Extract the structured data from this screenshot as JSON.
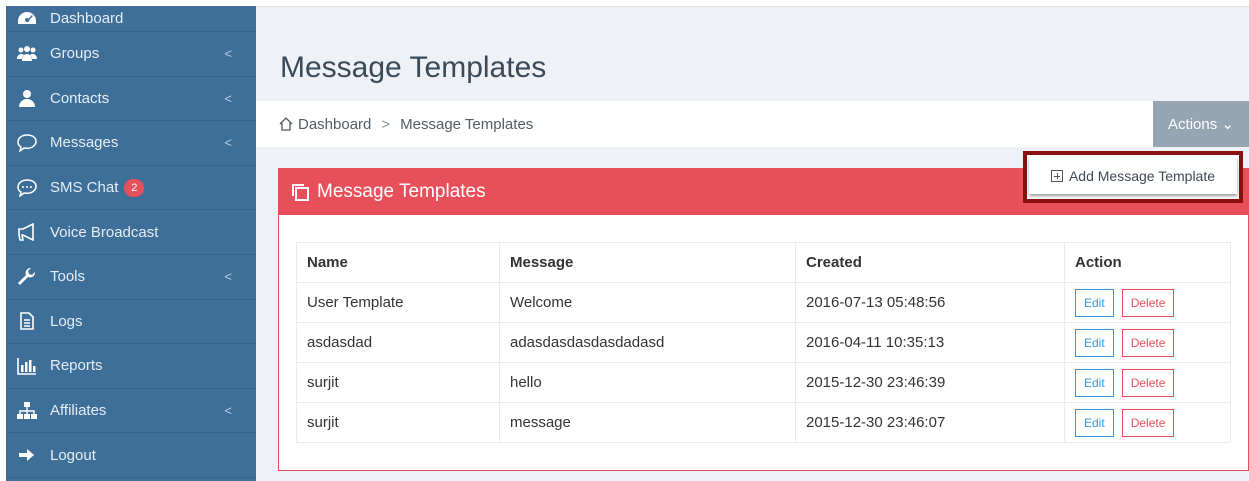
{
  "sidebar": {
    "items": [
      {
        "label": "Dashboard",
        "icon": "dashboard-icon",
        "has_chevron": false
      },
      {
        "label": "Groups",
        "icon": "users-icon",
        "has_chevron": true
      },
      {
        "label": "Contacts",
        "icon": "user-icon",
        "has_chevron": true
      },
      {
        "label": "Messages",
        "icon": "chat-bubble-icon",
        "has_chevron": true
      },
      {
        "label": "SMS Chat",
        "icon": "sms-chat-icon",
        "has_chevron": false,
        "badge": "2"
      },
      {
        "label": "Voice Broadcast",
        "icon": "megaphone-icon",
        "has_chevron": false
      },
      {
        "label": "Tools",
        "icon": "wrench-icon",
        "has_chevron": true
      },
      {
        "label": "Logs",
        "icon": "file-icon",
        "has_chevron": false
      },
      {
        "label": "Reports",
        "icon": "bar-chart-icon",
        "has_chevron": false
      },
      {
        "label": "Affiliates",
        "icon": "sitemap-icon",
        "has_chevron": true
      },
      {
        "label": "Logout",
        "icon": "logout-icon",
        "has_chevron": false
      }
    ],
    "chevron": "<"
  },
  "page": {
    "title": "Message Templates"
  },
  "breadcrumb": {
    "home": "Dashboard",
    "separator": ">",
    "current": "Message Templates"
  },
  "actions": {
    "label": "Actions ⌄"
  },
  "add_button": {
    "label": "Add Message Template"
  },
  "panel": {
    "title": "Message Templates"
  },
  "table": {
    "columns": [
      "Name",
      "Message",
      "Created",
      "Action"
    ],
    "rows": [
      {
        "name": "User Template",
        "message": "Welcome",
        "created": "2016-07-13 05:48:56"
      },
      {
        "name": "asdasdad",
        "message": "adasdasdasdasdadasd",
        "created": "2016-04-11 10:35:13"
      },
      {
        "name": "surjit",
        "message": "hello",
        "created": "2015-12-30 23:46:39"
      },
      {
        "name": "surjit",
        "message": "message",
        "created": "2015-12-30 23:46:07"
      }
    ],
    "edit_label": "Edit",
    "delete_label": "Delete"
  },
  "colors": {
    "sidebar_bg": "#3d6f99",
    "panel_accent": "#e7505a",
    "edit_blue": "#3598dc",
    "highlight_border": "#8b0f0f"
  }
}
